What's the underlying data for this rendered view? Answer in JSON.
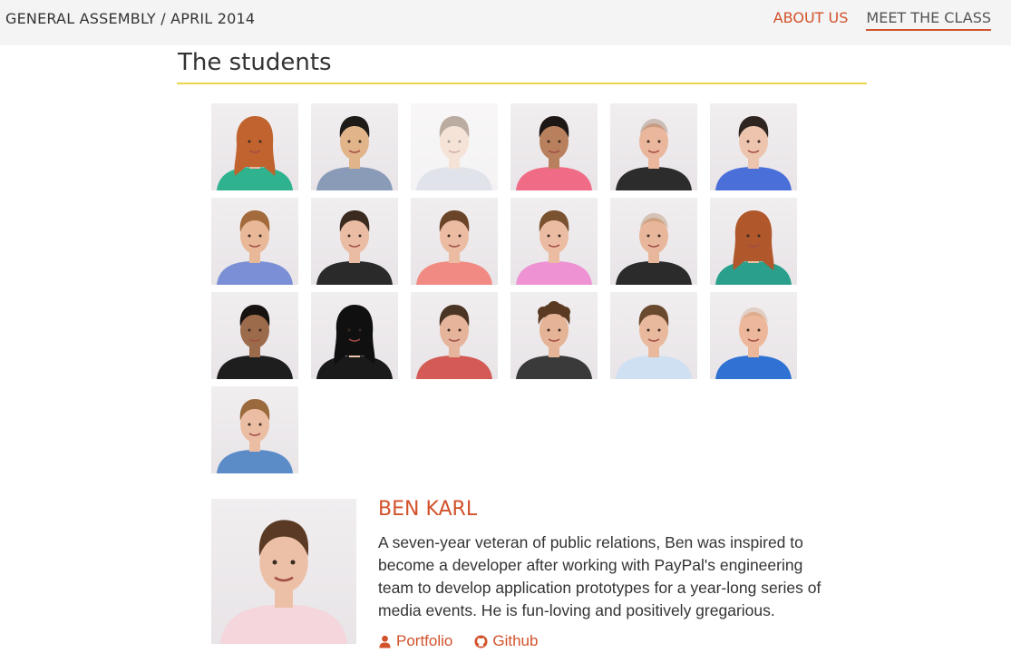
{
  "header": {
    "brand": "GENERAL ASSEMBLY / APRIL 2014",
    "nav": [
      {
        "label": "ABOUT US"
      },
      {
        "label": "MEET THE CLASS"
      }
    ]
  },
  "section": {
    "title": "The students"
  },
  "students": [
    {
      "skin": "#e8b9a0",
      "hair": "#c0632f",
      "shirt": "#2fb38f",
      "hairStyle": "long"
    },
    {
      "skin": "#e2b48a",
      "hair": "#1e1a18",
      "shirt": "#8a9bb8",
      "hairStyle": "short"
    },
    {
      "skin": "#e9c2ab",
      "hair": "#6b4a32",
      "shirt": "#bcc3d0",
      "hairStyle": "short",
      "dim": true
    },
    {
      "skin": "#b9805d",
      "hair": "#1c1714",
      "shirt": "#ef6b86",
      "hairStyle": "short"
    },
    {
      "skin": "#eab79d",
      "hair": "#8a6a4c",
      "shirt": "#2c2c2c",
      "hairStyle": "bald"
    },
    {
      "skin": "#edc4ae",
      "hair": "#2e2420",
      "shirt": "#4a6fd8",
      "hairStyle": "short"
    },
    {
      "skin": "#e8b899",
      "hair": "#a36a3b",
      "shirt": "#7a8fd6",
      "hairStyle": "short"
    },
    {
      "skin": "#eabca4",
      "hair": "#3a2a20",
      "shirt": "#2a2a2a",
      "hairStyle": "short"
    },
    {
      "skin": "#ebbca2",
      "hair": "#6a4428",
      "shirt": "#f08a82",
      "hairStyle": "short"
    },
    {
      "skin": "#ebbca2",
      "hair": "#7a5230",
      "shirt": "#ee92d4",
      "hairStyle": "short"
    },
    {
      "skin": "#e8b79b",
      "hair": "#a2774f",
      "shirt": "#2b2b2b",
      "hairStyle": "bald"
    },
    {
      "skin": "#edc0a3",
      "hair": "#b0582c",
      "shirt": "#2aa08c",
      "hairStyle": "long"
    },
    {
      "skin": "#9c6b4c",
      "hair": "#151210",
      "shirt": "#1e1e1e",
      "hairStyle": "short"
    },
    {
      "skin": "#eec6ad",
      "hair": "#111010",
      "shirt": "#1a1a1a",
      "hairStyle": "long"
    },
    {
      "skin": "#e6b49a",
      "hair": "#4a3424",
      "shirt": "#d35a55",
      "hairStyle": "short"
    },
    {
      "skin": "#e5b396",
      "hair": "#5a3a22",
      "shirt": "#3a3a3a",
      "hairStyle": "curly"
    },
    {
      "skin": "#e9b99d",
      "hair": "#6a4a2e",
      "shirt": "#cfe0f2",
      "hairStyle": "short"
    },
    {
      "skin": "#ecb79a",
      "hair": "#c89876",
      "shirt": "#2f72d3",
      "hairStyle": "bald"
    },
    {
      "skin": "#ebbea3",
      "hair": "#9a6a3c",
      "shirt": "#5b8cc8",
      "hairStyle": "short"
    }
  ],
  "selected": {
    "name": "BEN KARL",
    "bio": "A seven-year veteran of public relations, Ben was inspired to become a developer after working with PayPal's engineering team to develop application prototypes for a year-long series of media events. He is fun-loving and positively gregarious.",
    "links": [
      {
        "label": "Portfolio",
        "icon": "user-icon"
      },
      {
        "label": "Github",
        "icon": "github-icon"
      }
    ],
    "photo": {
      "skin": "#ecc0a6",
      "hair": "#5a3a24",
      "shirt": "#f4d6dc",
      "hairStyle": "short"
    }
  }
}
